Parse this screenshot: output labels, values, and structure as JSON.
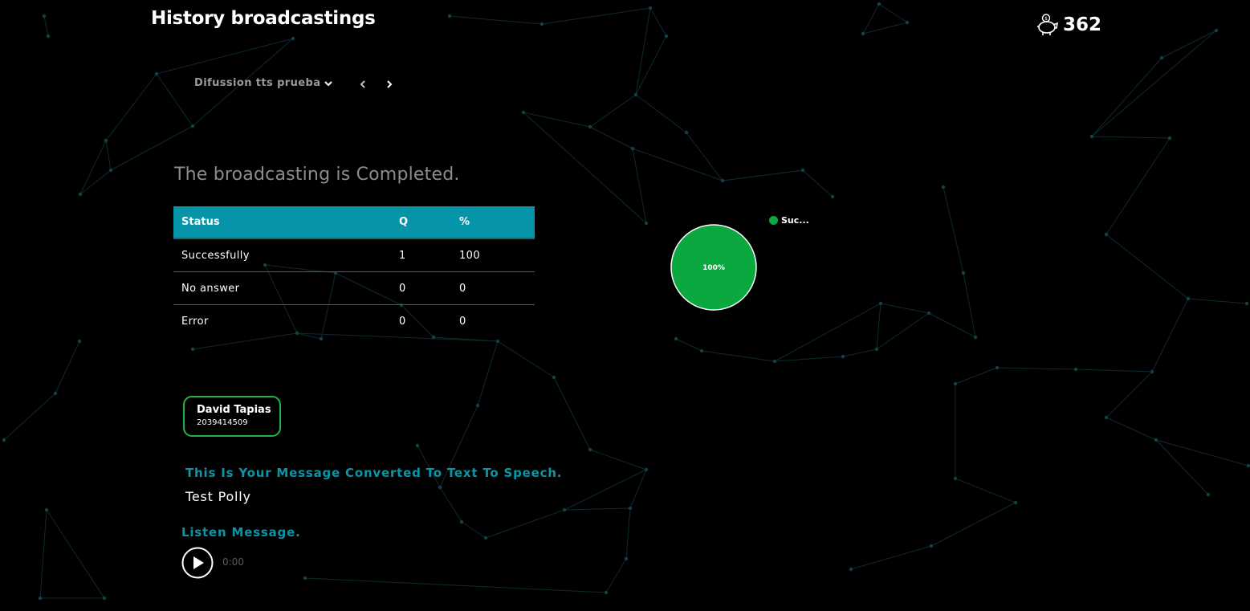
{
  "header": {
    "title": "History broadcastings",
    "credits_icon": "piggy-bank-icon",
    "credits_value": "362"
  },
  "toolbar": {
    "campaign_selected": "Difussion tts prueba",
    "dropdown_icon": "chevron-down-icon",
    "prev_icon": "chevron-left-icon",
    "next_icon": "chevron-right-icon"
  },
  "summary": {
    "heading": "The broadcasting is Completed.",
    "table": {
      "columns": [
        "Status",
        "Q",
        "%"
      ],
      "rows": [
        [
          "Successfully",
          "1",
          "100"
        ],
        [
          "No answer",
          "0",
          "0"
        ],
        [
          "Error",
          "0",
          "0"
        ]
      ]
    }
  },
  "chart_data": {
    "type": "pie",
    "values": [
      100
    ],
    "labels": [
      "100%"
    ],
    "legend": [
      "Suc..."
    ],
    "colors": [
      "#0aa83f"
    ],
    "legend_position": "top-right"
  },
  "contact": {
    "name": "David Tapias",
    "phone": "2039414509"
  },
  "message": {
    "heading": "This Is Your Message Converted To Text To Speech.",
    "text": "Test Polly"
  },
  "audio": {
    "heading": "Listen Message.",
    "play_icon": "play-icon",
    "time": "0:00"
  },
  "colors": {
    "accent": "#0695a8",
    "success": "#0aa83f",
    "background": "#000000",
    "network_lines": "#0e2a30"
  }
}
